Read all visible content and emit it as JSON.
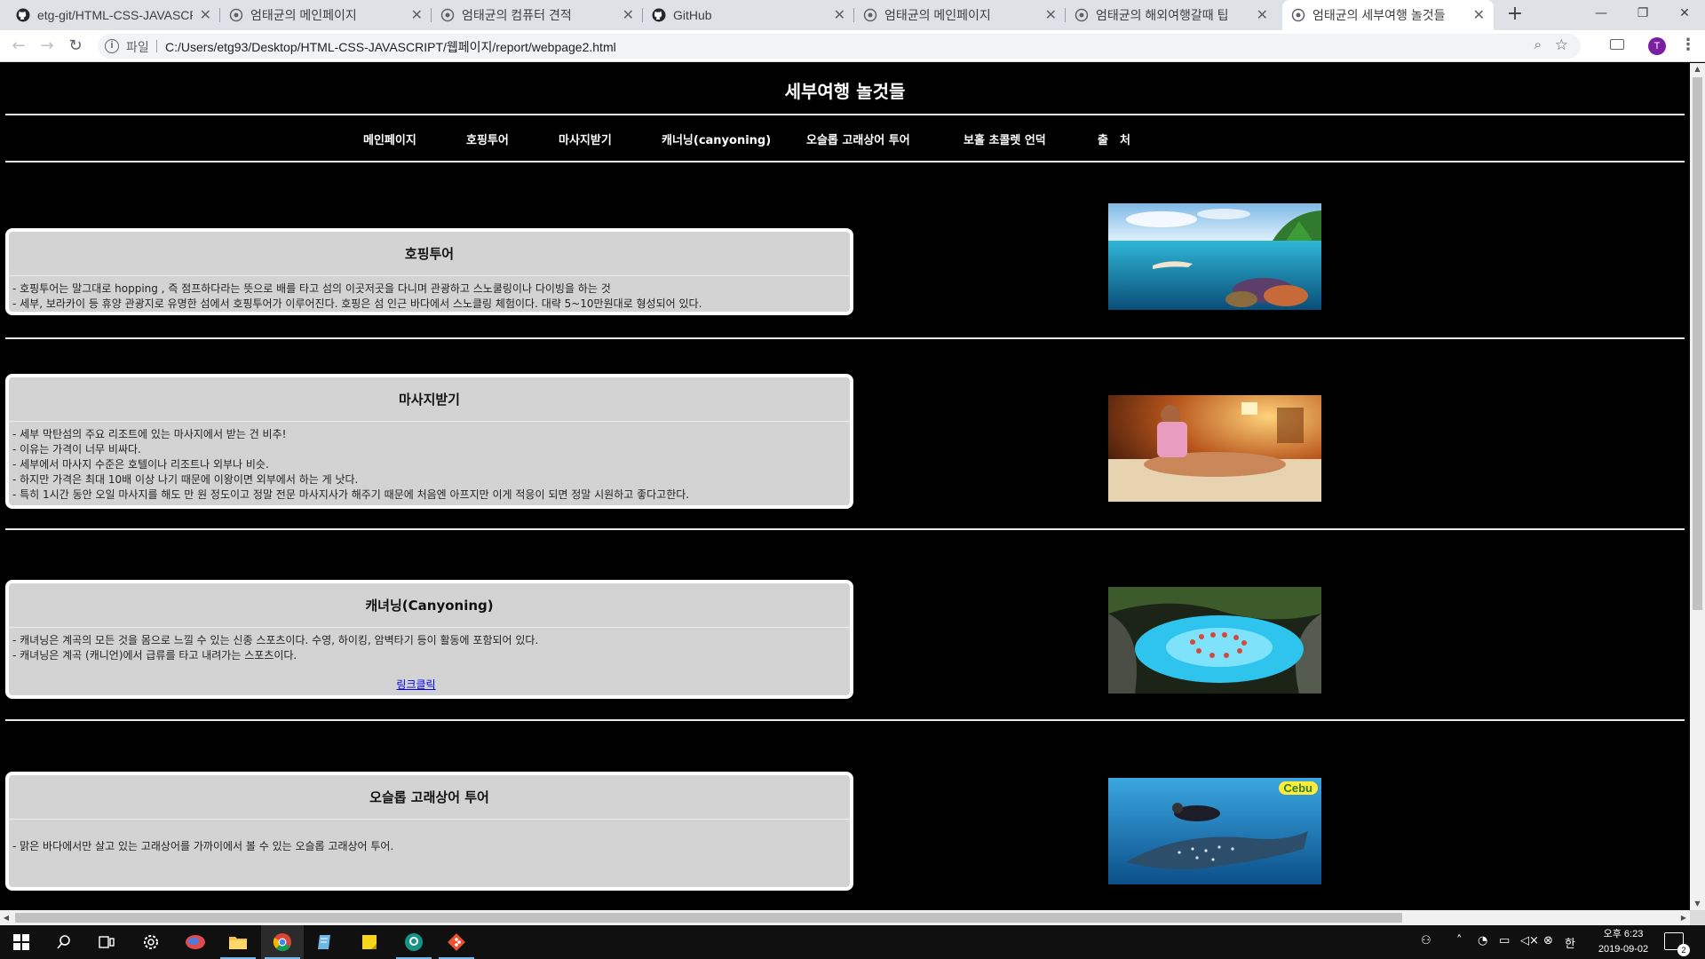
{
  "browser": {
    "tabs": [
      {
        "title": "etg-git/HTML-CSS-JAVASCR",
        "icon": "github-icon"
      },
      {
        "title": "엄태균의 메인페이지",
        "icon": "globe-icon"
      },
      {
        "title": "엄태균의 컴퓨터 견적",
        "icon": "globe-icon"
      },
      {
        "title": "GitHub",
        "icon": "github-icon"
      },
      {
        "title": "엄태균의 메인페이지",
        "icon": "globe-icon"
      },
      {
        "title": "엄태균의 해외여행갈때 팁",
        "icon": "globe-icon"
      },
      {
        "title": "엄태균의 세부여행 놀것들",
        "icon": "globe-icon"
      }
    ],
    "active_tab_index": 6,
    "new_tab": "+",
    "address": {
      "scheme_label": "파일",
      "url": "C:/Users/etg93/Desktop/HTML-CSS-JAVASCRIPT/웹페이지/report/webpage2.html"
    },
    "profile_initial": "T"
  },
  "page": {
    "title": "세부여행 놀것들",
    "nav": [
      "메인페이지",
      "호핑투어",
      "마사지받기",
      "캐너닝(canyoning)",
      "오슬롭 고래상어 투어",
      "보홀 초콜렛 언덕",
      "출　처"
    ],
    "sections": [
      {
        "heading": "호핑투어",
        "lines": [
          "- 호핑투어는 말그대로 hopping , 즉 점프하다라는 뜻으로 배를 타고 섬의 이곳저곳을 다니며 관광하고 스노쿨링이나 다이빙을 하는 것",
          "- 세부, 보라카이 등 휴양 관광지로 유명한 섬에서 호핑투어가 이루어진다. 호핑은 섬 인근 바다에서 스노클링 체험이다. 대략 5~10만원대로 형성되어 있다."
        ],
        "image": "underwater-snorkel-image"
      },
      {
        "heading": "마사지받기",
        "lines": [
          "- 세부 막탄섬의 주요 리조트에 있는 마사지에서 받는 건 비추!",
          "- 이유는 가격이 너무 비싸다.",
          "- 세부에서 마사지 수준은 호텔이나 리조트나 외부나 비슷.",
          "- 하지만 가격은 최대 10배 이상 나기 때문에 이왕이면 외부에서 하는 게 낫다.",
          "- 특히 1시간 동안 오일 마사지를 해도 만 원 정도이고 정말 전문 마사지사가 해주기 때문에 처음엔 아프지만 이게 적응이 되면 정말 시원하고 좋다고한다."
        ],
        "image": "massage-image"
      },
      {
        "heading": "캐녀닝(Canyoning)",
        "lines": [
          "- 캐녀닝은 계곡의 모든 것을 몸으로 느낄 수 있는 신종 스포츠이다. 수영, 하이킹, 암벽타기 등이 활동에 포함되어 있다.",
          "- 캐녀닝은 계곡 (캐니언)에서 급류를 타고 내려가는 스포츠이다."
        ],
        "link": "링크클릭",
        "image": "canyon-pool-image"
      },
      {
        "heading": "오슬롭 고래상어 투어",
        "lines": [
          "- 맑은 바다에서만 살고 있는 고래상어를 가까이에서 볼 수 있는 오슬롭 고래상어 투어."
        ],
        "image": "whale-shark-image",
        "image_badge": "Cebu"
      }
    ]
  },
  "taskbar": {
    "apps": [
      "windows-start-icon",
      "search-icon",
      "task-view-icon",
      "settings-icon",
      "app-icon",
      "file-explorer-icon",
      "chrome-icon",
      "notepad-icon",
      "sticky-notes-icon",
      "gitkraken-icon",
      "git-icon"
    ],
    "clock": {
      "time": "오후 6:23",
      "date": "2019-09-02"
    },
    "notification_count": "2"
  }
}
